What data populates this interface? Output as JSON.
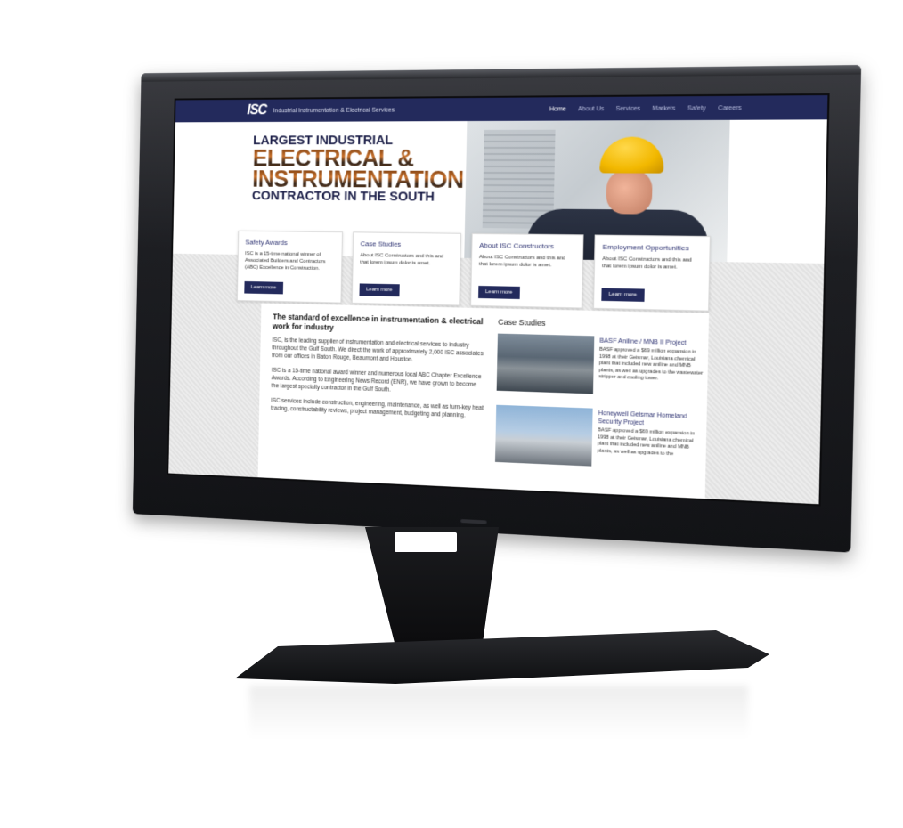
{
  "nav": {
    "logo": "ISC",
    "tagline": "Industrial Instrumentation & Electrical Services",
    "menu": [
      "Home",
      "About Us",
      "Services",
      "Markets",
      "Safety",
      "Careers"
    ],
    "active_index": 0
  },
  "hero": {
    "line1": "LARGEST INDUSTRIAL",
    "line2": "ELECTRICAL &",
    "line3": "INSTRUMENTATION",
    "line4": "CONTRACTOR IN THE SOUTH"
  },
  "cards": [
    {
      "title": "Safety Awards",
      "text": "ISC is a 15-time national winner of Associated Builders and Contractors (ABC) Excellence in Construction.",
      "button": "Learn more"
    },
    {
      "title": "Case Studies",
      "text": "About ISC Constructors and this and that lorem ipsum dolor is amet.",
      "button": "Learn more"
    },
    {
      "title": "About ISC Constructors",
      "text": "About ISC Constructors and this and that lorem ipsum dolor is amet.",
      "button": "Learn more"
    },
    {
      "title": "Employment Opportunities",
      "text": "About ISC Constructors and this and that lorem ipsum dolor is amet.",
      "button": "Learn more"
    }
  ],
  "main": {
    "title": "The standard of excellence in instrumentation & electrical work for industry",
    "paragraphs": [
      "ISC, is the leading supplier of instrumentation and electrical services to industry throughout the Gulf South. We direct the work of approximately 2,000 ISC associates from our offices in Baton Rouge, Beaumont and Houston.",
      "ISC is a 15-time national award winner and numerous local ABC Chapter Excellence Awards. According to Engineering News Record (ENR), we have grown to become the largest specialty contractor in the Gulf South.",
      "ISC services include construction, engineering, maintenance, as well as turn-key heat tracing, constructability reviews, project management, budgeting and planning."
    ]
  },
  "case_studies": {
    "heading": "Case Studies",
    "items": [
      {
        "title": "BASF Aniline / MNB II Project",
        "text": "BASF approved a $69 million expansion in 1998 at their Geismar, Louisiana chemical plant that included new aniline and MNB plants, as well as upgrades to the wastewater stripper and cooling tower."
      },
      {
        "title": "Honeywell Geismar Homeland Security Project",
        "text": "BASF approved a $69 million expansion in 1998 at their Geismar, Louisiana chemical plant that included new aniline and MNB plants, as well as upgrades to the"
      }
    ]
  }
}
